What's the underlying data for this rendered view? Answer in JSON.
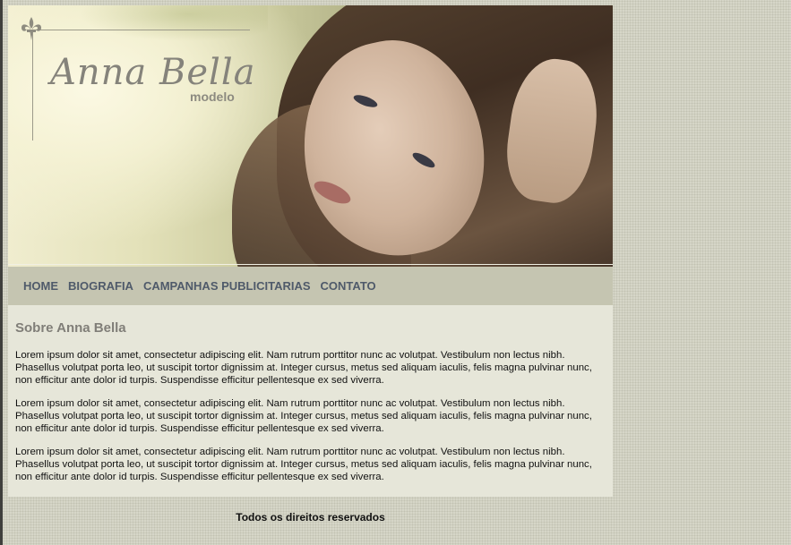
{
  "brand": {
    "title": "Anna Bella",
    "subtitle": "modelo"
  },
  "nav": {
    "items": [
      {
        "label": "HOME"
      },
      {
        "label": "BIOGRAFIA"
      },
      {
        "label": "CAMPANHAS PUBLICITARIAS"
      },
      {
        "label": "CONTATO"
      }
    ]
  },
  "main": {
    "heading": "Sobre Anna Bella",
    "paragraphs": [
      "Lorem ipsum dolor sit amet, consectetur adipiscing elit. Nam rutrum porttitor nunc ac volutpat. Vestibulum non lectus nibh. Phasellus volutpat porta leo, ut suscipit tortor dignissim at. Integer cursus, metus sed aliquam iaculis, felis magna pulvinar nunc, non efficitur ante dolor id turpis. Suspendisse efficitur pellentesque ex sed viverra.",
      "Lorem ipsum dolor sit amet, consectetur adipiscing elit. Nam rutrum porttitor nunc ac volutpat. Vestibulum non lectus nibh. Phasellus volutpat porta leo, ut suscipit tortor dignissim at. Integer cursus, metus sed aliquam iaculis, felis magna pulvinar nunc, non efficitur ante dolor id turpis. Suspendisse efficitur pellentesque ex sed viverra.",
      "Lorem ipsum dolor sit amet, consectetur adipiscing elit. Nam rutrum porttitor nunc ac volutpat. Vestibulum non lectus nibh. Phasellus volutpat porta leo, ut suscipit tortor dignissim at. Integer cursus, metus sed aliquam iaculis, felis magna pulvinar nunc, non efficitur ante dolor id turpis. Suspendisse efficitur pellentesque ex sed viverra."
    ]
  },
  "footer": {
    "text": "Todos os direitos reservados"
  },
  "icons": {
    "logo_ornament": "fleur-de-lis-icon"
  },
  "colors": {
    "page_background": "#d6d6c8",
    "nav_background": "#c5c5b1",
    "nav_text": "#4f5a6a",
    "content_background": "#e6e6d9",
    "heading_text": "#807e78",
    "logo_text": "#85837b"
  }
}
